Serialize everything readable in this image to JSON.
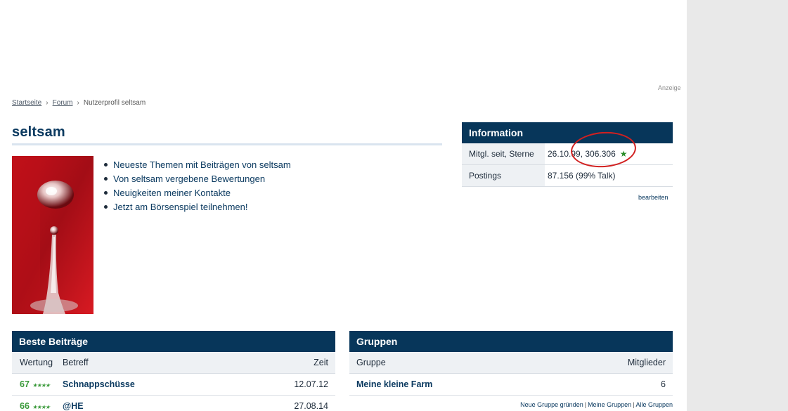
{
  "ad": {
    "label": "Anzeige"
  },
  "breadcrumb": {
    "items": [
      "Startseite",
      "Forum"
    ],
    "current": "Nutzerprofil seltsam"
  },
  "profile": {
    "name": "seltsam",
    "links": [
      "Neueste Themen mit Beiträgen von seltsam",
      "Von seltsam vergebene Bewertungen",
      "Neuigkeiten meiner Kontakte",
      "Jetzt am Börsenspiel teilnehmen!"
    ]
  },
  "info": {
    "title": "Information",
    "rows": [
      {
        "label": "Mitgl. seit, Sterne",
        "value": "26.10.99, 306.306"
      },
      {
        "label": "Postings",
        "value": "87.156 (99% Talk)"
      }
    ],
    "edit": "bearbeiten"
  },
  "posts": {
    "title": "Beste Beiträge",
    "headers": {
      "rating": "Wertung",
      "subject": "Betreff",
      "time": "Zeit"
    },
    "rows": [
      {
        "rating": "67",
        "subject": "Schnappschüsse",
        "time": "12.07.12"
      },
      {
        "rating": "66",
        "subject": "@HE",
        "time": "27.08.14"
      }
    ]
  },
  "groups": {
    "title": "Gruppen",
    "headers": {
      "group": "Gruppe",
      "members": "Mitglieder"
    },
    "rows": [
      {
        "group": "Meine kleine Farm",
        "members": "6"
      }
    ],
    "footer": [
      "Neue Gruppe gründen",
      "Meine Gruppen",
      "Alle Gruppen"
    ]
  },
  "colors": {
    "header_bg": "#07365a",
    "accent_green": "#3a9a3a",
    "annotation_red": "#d12020"
  }
}
